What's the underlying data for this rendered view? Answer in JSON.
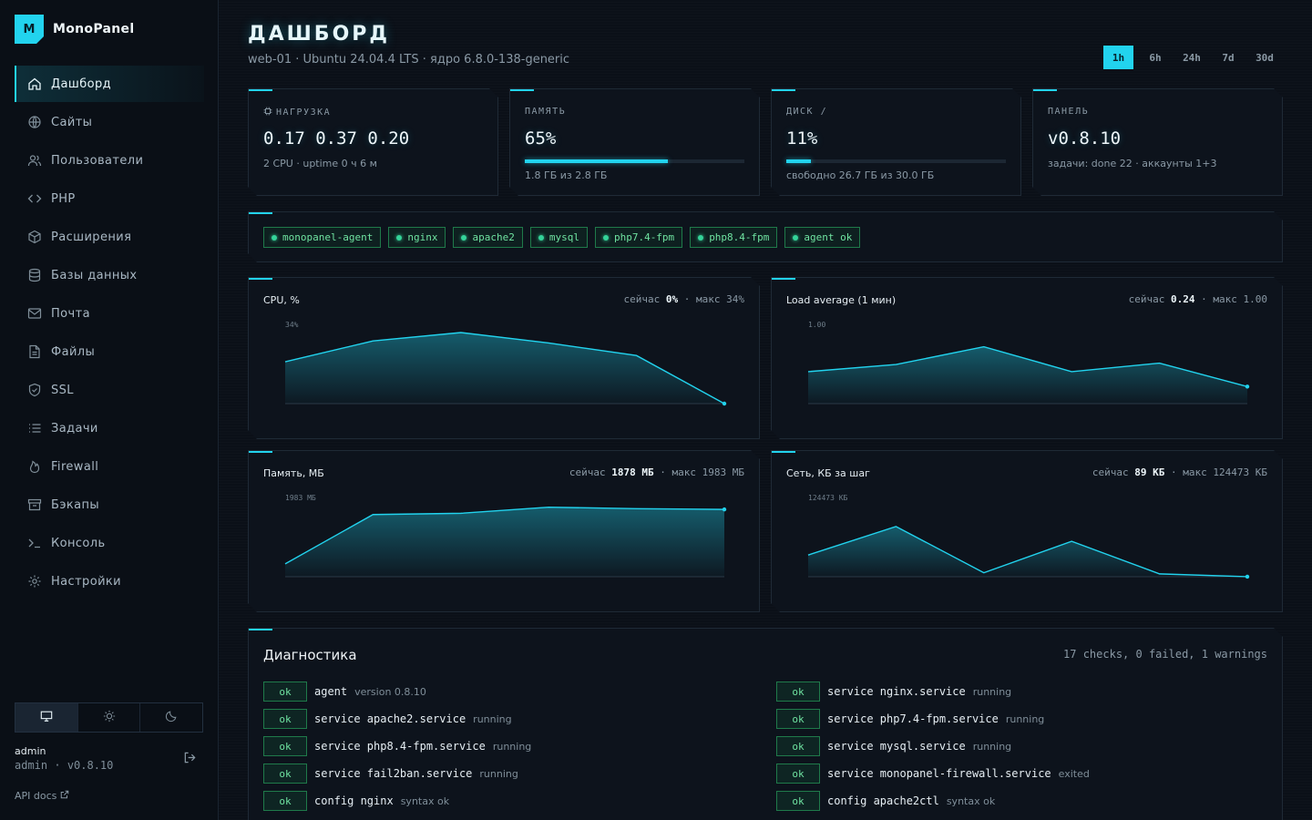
{
  "app": {
    "name": "MonoPanel",
    "logo_letter": "M"
  },
  "sidebar": {
    "items": [
      {
        "label": "Дашборд",
        "icon": "home-icon",
        "active": true
      },
      {
        "label": "Сайты",
        "icon": "globe-icon"
      },
      {
        "label": "Пользователи",
        "icon": "users-icon"
      },
      {
        "label": "PHP",
        "icon": "code-icon"
      },
      {
        "label": "Расширения",
        "icon": "package-icon"
      },
      {
        "label": "Базы данных",
        "icon": "database-icon"
      },
      {
        "label": "Почта",
        "icon": "mail-icon"
      },
      {
        "label": "Файлы",
        "icon": "file-icon"
      },
      {
        "label": "SSL",
        "icon": "shield-icon"
      },
      {
        "label": "Задачи",
        "icon": "list-icon"
      },
      {
        "label": "Firewall",
        "icon": "flame-icon"
      },
      {
        "label": "Бэкапы",
        "icon": "archive-icon"
      },
      {
        "label": "Консоль",
        "icon": "terminal-icon"
      },
      {
        "label": "Настройки",
        "icon": "gear-icon"
      }
    ],
    "theme": {
      "options": [
        "monitor-icon",
        "sun-icon",
        "moon-icon"
      ],
      "active": "monitor-icon"
    },
    "user": {
      "name": "admin",
      "role": "admin",
      "version": "v0.8.10"
    },
    "api_docs": "API docs"
  },
  "header": {
    "title": "ДАШБОРД",
    "subtitle": "web-01 · Ubuntu 24.04.4 LTS · ядро 6.8.0-138-generic",
    "ranges": [
      "1h",
      "6h",
      "24h",
      "7d",
      "30d"
    ],
    "active_range": "1h"
  },
  "stats": {
    "load": {
      "label": "НАГРУЗКА",
      "value": "0.17 0.37 0.20",
      "note": "2 CPU · uptime 0 ч 6 м"
    },
    "memory": {
      "label": "ПАМЯТЬ",
      "value": "65%",
      "percent": 65,
      "note": "1.8 ГБ из 2.8 ГБ"
    },
    "disk": {
      "label": "ДИСК /",
      "value": "11%",
      "percent": 11,
      "note": "свободно 26.7 ГБ из 30.0 ГБ"
    },
    "panel": {
      "label": "ПАНЕЛЬ",
      "value": "v0.8.10",
      "note": "задачи: done 22 · аккаунты 1+3"
    }
  },
  "services": [
    "monopanel-agent",
    "nginx",
    "apache2",
    "mysql",
    "php7.4-fpm",
    "php8.4-fpm",
    "agent ok"
  ],
  "charts": {
    "cpu": {
      "title": "CPU, %",
      "now_label": "сейчас",
      "now": "0%",
      "max_label": "макс",
      "max": "34%",
      "peak_label": "34%"
    },
    "load": {
      "title": "Load average (1 мин)",
      "now_label": "сейчас",
      "now": "0.24",
      "max_label": "макс",
      "max": "1.00",
      "peak_label": "1.00"
    },
    "mem": {
      "title": "Память, МБ",
      "now_label": "сейчас",
      "now": "1878 МБ",
      "max_label": "макс",
      "max": "1983 МБ",
      "peak_label": "1983 МБ"
    },
    "net": {
      "title": "Сеть, КБ за шаг",
      "now_label": "сейчас",
      "now": "89 КБ",
      "max_label": "макс",
      "max": "124473 КБ",
      "peak_label": "124473 КБ"
    }
  },
  "chart_data": [
    {
      "type": "area",
      "title": "CPU, %",
      "x": [
        1,
        2,
        3,
        4,
        5,
        6
      ],
      "values": [
        20,
        30,
        34,
        29,
        23,
        0
      ],
      "ylim": [
        0,
        34
      ]
    },
    {
      "type": "area",
      "title": "Load average (1 мин)",
      "x": [
        1,
        2,
        3,
        4,
        5,
        6
      ],
      "values": [
        0.45,
        0.55,
        0.8,
        0.45,
        0.57,
        0.24
      ],
      "ylim": [
        0,
        1.0
      ]
    },
    {
      "type": "area",
      "title": "Память, МБ",
      "x": [
        1,
        2,
        3,
        4,
        5,
        6
      ],
      "values": [
        360,
        1735,
        1770,
        1940,
        1900,
        1878
      ],
      "ylim": [
        0,
        1983
      ]
    },
    {
      "type": "area",
      "title": "Сеть, КБ за шаг",
      "x": [
        1,
        2,
        3,
        4,
        5,
        6
      ],
      "values": [
        38000,
        88000,
        7000,
        62000,
        5000,
        89
      ],
      "ylim": [
        0,
        124473
      ]
    }
  ],
  "diagnostics": {
    "title": "Диагностика",
    "summary": "17 checks, 0 failed, 1 warnings",
    "left": [
      {
        "status": "ok",
        "name": "agent",
        "detail": "version 0.8.10"
      },
      {
        "status": "ok",
        "name": "service apache2.service",
        "detail": "running"
      },
      {
        "status": "ok",
        "name": "service php8.4-fpm.service",
        "detail": "running"
      },
      {
        "status": "ok",
        "name": "service fail2ban.service",
        "detail": "running"
      },
      {
        "status": "ok",
        "name": "config nginx",
        "detail": "syntax ok"
      }
    ],
    "right": [
      {
        "status": "ok",
        "name": "service nginx.service",
        "detail": "running"
      },
      {
        "status": "ok",
        "name": "service php7.4-fpm.service",
        "detail": "running"
      },
      {
        "status": "ok",
        "name": "service mysql.service",
        "detail": "running"
      },
      {
        "status": "ok",
        "name": "service monopanel-firewall.service",
        "detail": "exited"
      },
      {
        "status": "ok",
        "name": "config apache2ctl",
        "detail": "syntax ok"
      }
    ]
  },
  "colors": {
    "accent": "#22d3ee",
    "ok": "#34d399",
    "bg": "#0b1018"
  }
}
